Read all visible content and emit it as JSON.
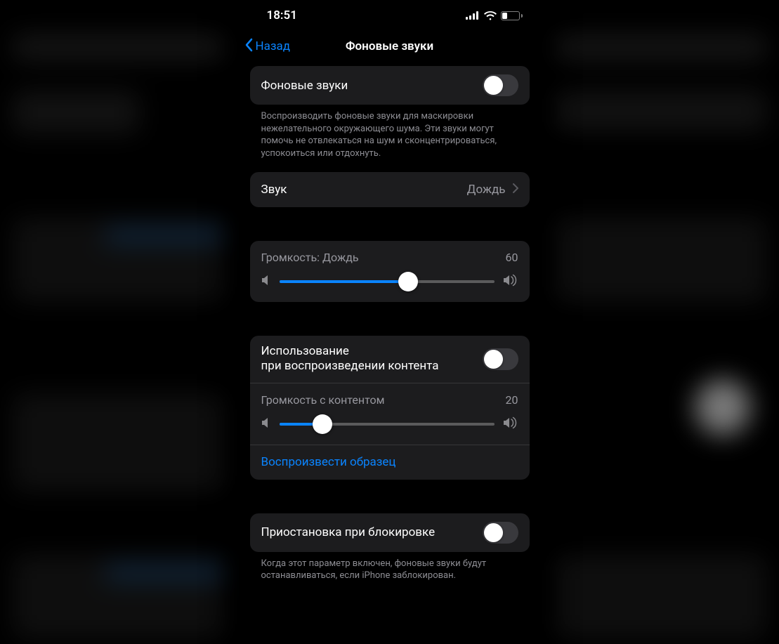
{
  "status": {
    "time": "18:51",
    "battery_percent": "31"
  },
  "nav": {
    "back": "Назад",
    "title": "Фоновые звуки"
  },
  "section_main": {
    "toggle_label": "Фоновые звуки",
    "description": "Воспроизводить фоновые звуки для маскировки нежелательного окружающего шума. Эти звуки могут помочь не отвлекаться на шум и сконцентрироваться, успокоиться или отдохнуть."
  },
  "section_sound": {
    "label": "Звук",
    "value": "Дождь"
  },
  "section_volume": {
    "label": "Громкость: Дождь",
    "value": "60",
    "percent": 60
  },
  "section_media": {
    "toggle_label": "Использование\nпри воспроизведении контента",
    "volume_label": "Громкость с контентом",
    "volume_value": "20",
    "volume_percent": 20,
    "sample_label": "Воспроизвести образец"
  },
  "section_lock": {
    "toggle_label": "Приостановка при блокировке",
    "description": "Когда этот параметр включен, фоновые звуки будут останавливаться, если iPhone заблокирован."
  }
}
